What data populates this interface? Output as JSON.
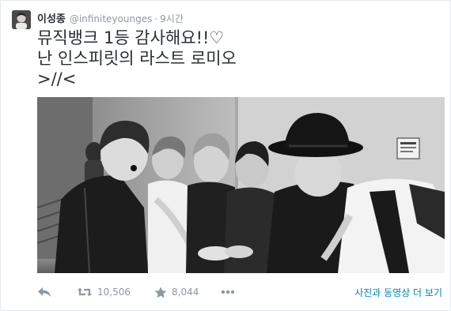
{
  "tweet": {
    "display_name": "이성종",
    "username": "@infiniteyounges",
    "separator": "·",
    "timestamp": "9시간",
    "text_lines": [
      "뮤직뱅크 1등 감사해요!!♡",
      "난 인스피릿의 라스트 로미오",
      ">//<"
    ]
  },
  "actions": {
    "reply_icon": "reply-icon",
    "retweet_icon": "retweet-icon",
    "retweet_count": "10,506",
    "favorite_icon": "star-icon",
    "favorite_count": "8,044",
    "more_icon": "ellipsis-icon",
    "view_media_label": "사진과 동영상 더 보기"
  },
  "colors": {
    "text": "#292f33",
    "muted": "#8899a6",
    "link": "#0084b4",
    "border": "#e1e8ed"
  }
}
